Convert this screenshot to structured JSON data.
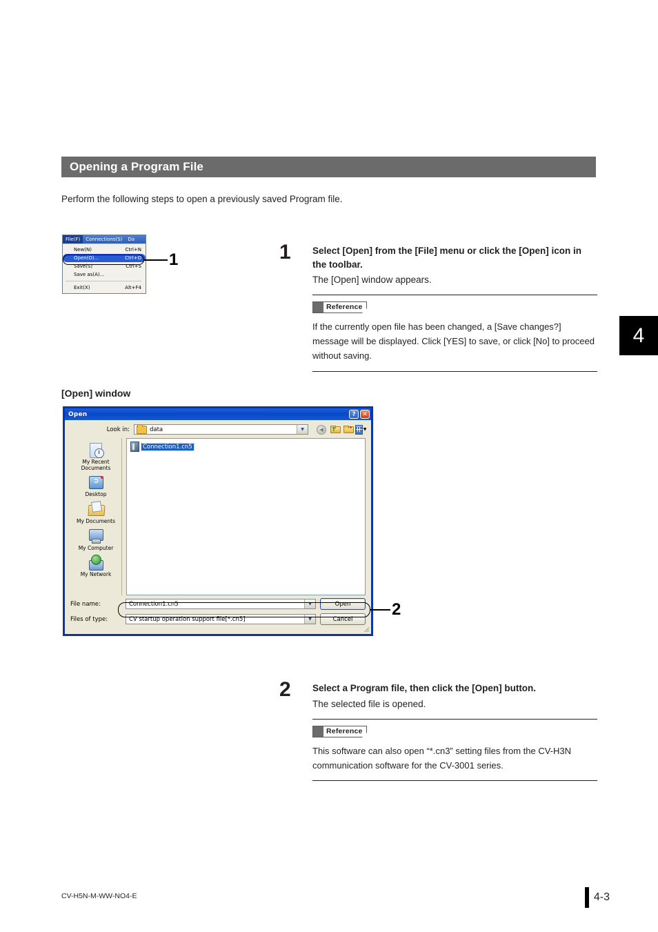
{
  "section": {
    "heading": "Opening a Program File",
    "intro": "Perform the following steps to open a previously saved Program file."
  },
  "chapter_tab": {
    "number": "4"
  },
  "menu_screenshot": {
    "menubar": [
      {
        "label": "File(F)",
        "active": true
      },
      {
        "label": "Connections(S)",
        "active": false
      },
      {
        "label": "Da",
        "active": false
      }
    ],
    "items": [
      {
        "label": "New(N)",
        "accel": "Ctrl+N",
        "highlight": false
      },
      {
        "label": "Open(O)...",
        "accel": "Ctrl+O",
        "highlight": true
      },
      {
        "label": "Save(S)",
        "accel": "Ctrl+S",
        "highlight": false
      },
      {
        "label": "Save as(A)...",
        "accel": "",
        "highlight": false
      },
      {
        "label": "Exit(X)",
        "accel": "Alt+F4",
        "highlight": false
      }
    ]
  },
  "callouts": {
    "one": "1",
    "two": "2"
  },
  "steps": [
    {
      "number": "1",
      "heading": "Select [Open] from the [File] menu or click the [Open] icon in the toolbar.",
      "subtext": "The [Open] window appears.",
      "reference_label": "Reference",
      "reference_text": "If the currently open file has been changed, a [Save changes?] message will be displayed. Click [YES] to save, or click [No] to proceed without saving."
    },
    {
      "number": "2",
      "heading": "Select a Program file, then click the [Open] button.",
      "subtext": "The selected file is opened.",
      "reference_label": "Reference",
      "reference_text": "This software can also open “*.cn3” setting files from the CV-H3N communication software for the CV-3001 series."
    }
  ],
  "open_window": {
    "caption": "[Open] window",
    "title": "Open",
    "help_button": "?",
    "close_button": "✕",
    "look_in_label": "Look in:",
    "look_in_value": "data",
    "toolbar_icons": [
      "back-icon",
      "up-folder-icon",
      "new-folder-icon",
      "views-icon"
    ],
    "places": [
      {
        "name": "my-recent-documents",
        "label": "My Recent Documents"
      },
      {
        "name": "desktop",
        "label": "Desktop"
      },
      {
        "name": "my-documents",
        "label": "My Documents"
      },
      {
        "name": "my-computer",
        "label": "My Computer"
      },
      {
        "name": "my-network",
        "label": "My Network"
      }
    ],
    "files": [
      {
        "name": "Connection1.cn5",
        "selected": true
      }
    ],
    "file_name_label": "File name:",
    "file_name_value": "Connection1.cn5",
    "files_of_type_label": "Files of type:",
    "files_of_type_value": "CV startup operation support file[*.cn5]",
    "open_button": "Open",
    "cancel_button": "Cancel"
  },
  "footer": {
    "doc_code": "CV-H5N-M-WW-NO4-E",
    "page_number": "4-3"
  },
  "colors": {
    "heading_bar": "#6b6b6b",
    "dialog_border": "#0a35a5",
    "titlebar": "#0a48c8",
    "selection": "#1d5fbf",
    "menu_highlight": "#2a5bd7"
  }
}
